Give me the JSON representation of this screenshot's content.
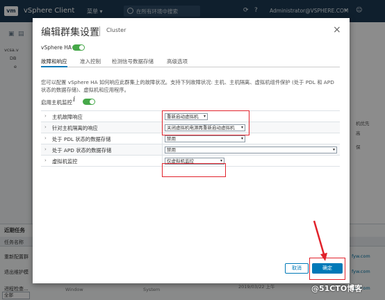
{
  "topbar": {
    "logo": "vm",
    "app_title": "vSphere Client",
    "menu": "菜单 ▾",
    "search_placeholder": "在所有环境中搜索",
    "user": "Administrator@VSPHERE.COM",
    "user_chevron": "▾"
  },
  "sidebar": {
    "items": [
      "vcsa.v",
      "DB",
      "e"
    ]
  },
  "right_strip": {
    "texts": [
      "机优先",
      "高",
      "保"
    ]
  },
  "tasks": {
    "tab_label": "近期任务",
    "column": "任务名称",
    "rows": [
      "重新配置群",
      "退出维护模",
      "进程检查..."
    ],
    "links": [
      "fyw.com",
      "fyw.com",
      "fyw.com"
    ],
    "status_cells": [
      "2019/03/22 上午",
      "Window",
      "System"
    ],
    "filter": "全部"
  },
  "dialog": {
    "title": "编辑群集设置",
    "subtitle": "Cluster",
    "close": "×",
    "ha_label": "vSphere HA",
    "tabs": [
      {
        "label": "故障和响应"
      },
      {
        "label": "准入控制"
      },
      {
        "label": "检测信号数据存储"
      },
      {
        "label": "高级选项"
      }
    ],
    "description": "您可以配置 vSphere HA 如何响应此群集上的故障状况。支持下列故障状况: 主机、主机隔离、虚拟机组件保护 (处于 PDL 和 APD 状态的数据存储)、虚拟机和应用程序。",
    "monitor_label": "启用主机监控",
    "info": "i",
    "rows": [
      {
        "label": "主机故障响应",
        "value": "重新启动虚拟机"
      },
      {
        "label": "针对主机隔离的响应",
        "value": "关闭虚拟机电源再重新启动虚拟机"
      },
      {
        "label": "处于 PDL 状态的数据存储",
        "value": "禁用"
      },
      {
        "label": "处于 APD 状态的数据存储",
        "value": "禁用"
      },
      {
        "label": "虚拟机监控",
        "value": "仅虚拟机监控"
      }
    ],
    "cancel_label": "取消",
    "ok_label": "确定"
  },
  "watermark": "@51CTO博客",
  "colors": {
    "topbar": "#1d3a53",
    "accent": "#0079b8",
    "toggle_on": "#46a849",
    "highlight": "#e1222b"
  }
}
